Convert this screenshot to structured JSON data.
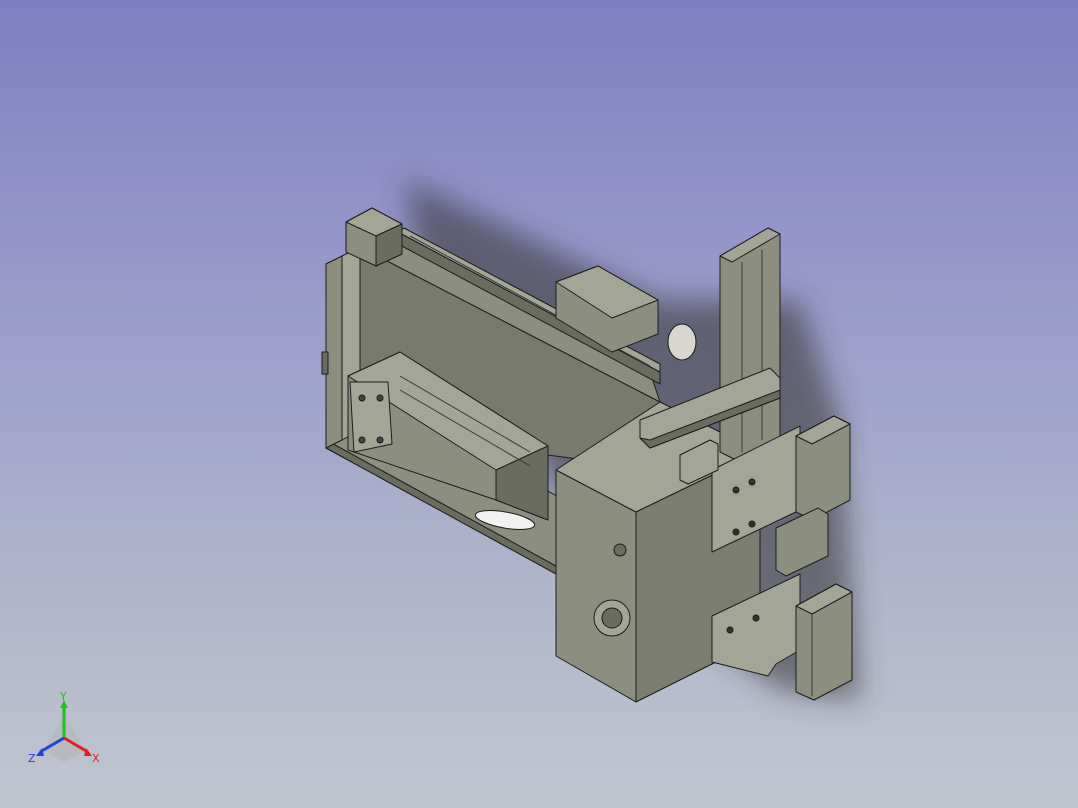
{
  "viewport": {
    "background_top": "#7e7fc1",
    "background_bottom": "#c1c6d0"
  },
  "model": {
    "description_icon": "cad-assembly-icon",
    "colors": {
      "face_light": "#a3a596",
      "face_mid": "#8c8e80",
      "face_dark": "#6a6c60",
      "edge": "#1c1c1c",
      "shadow": "#3a3a3a"
    }
  },
  "triad": {
    "x_label": "X",
    "y_label": "Y",
    "z_label": "Z",
    "x_color": "#e02020",
    "y_color": "#20c020",
    "z_color": "#2040e0"
  }
}
